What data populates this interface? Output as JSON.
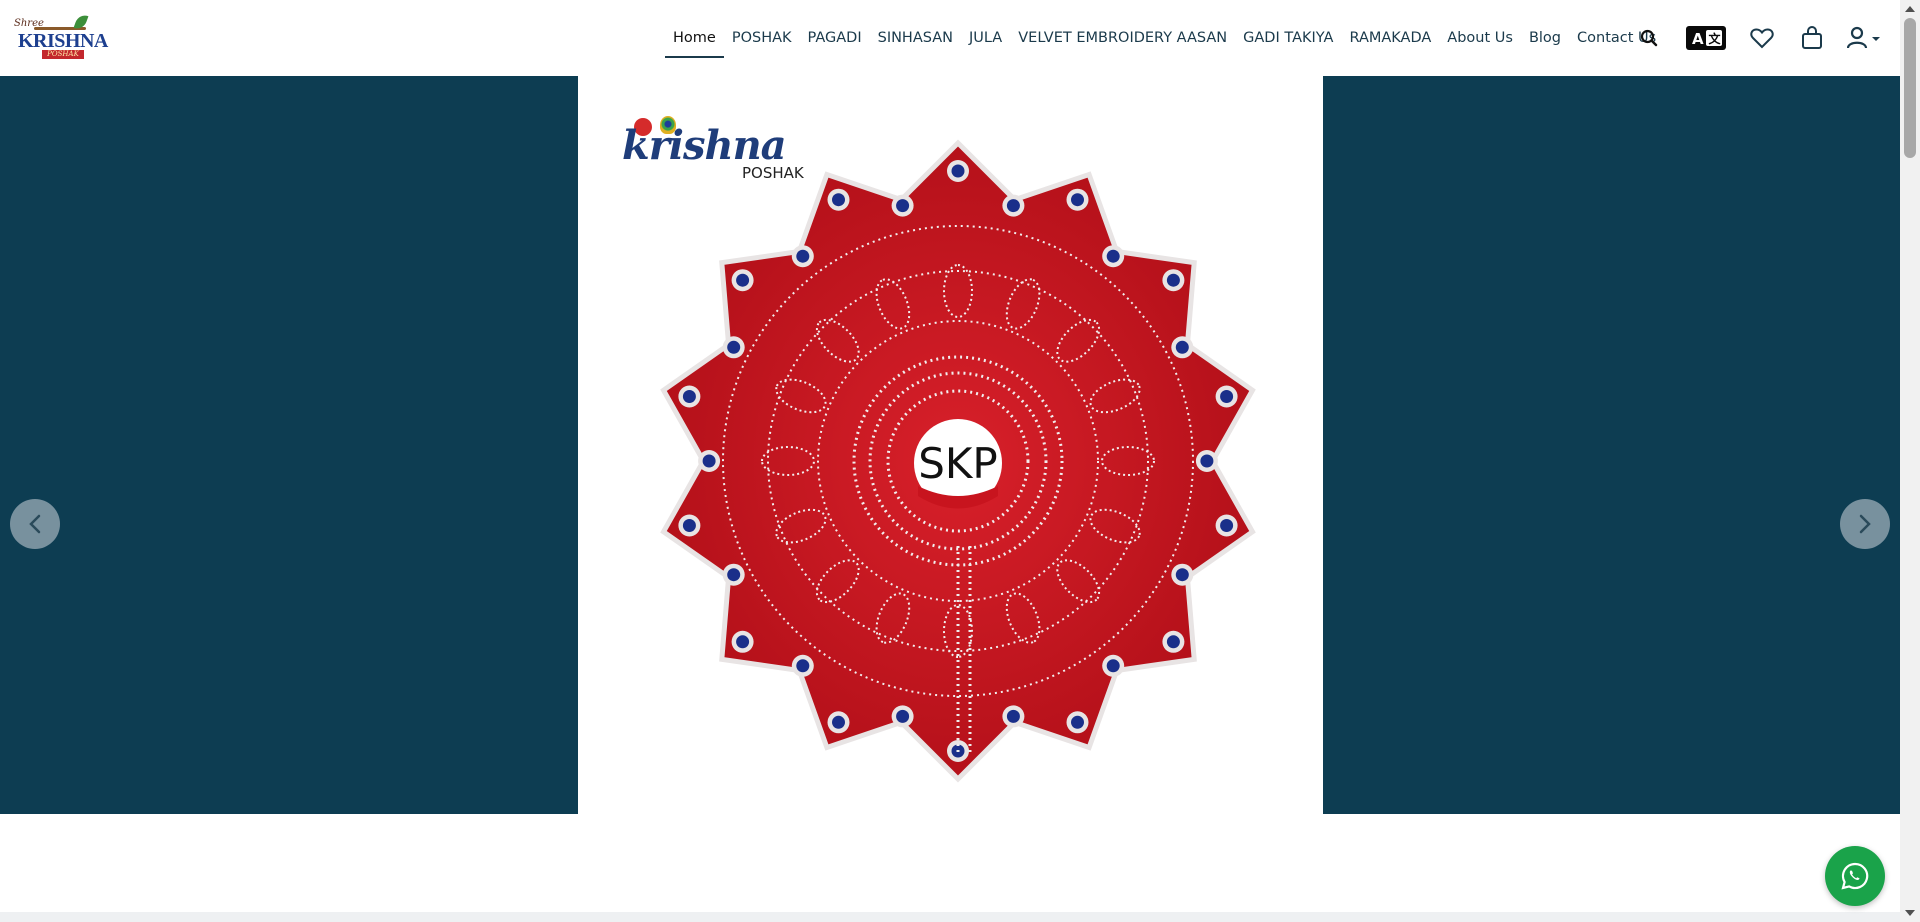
{
  "header": {
    "logo": {
      "shree": "Shree",
      "name": "KRISHNA",
      "tagline": "POSHAK"
    },
    "nav": [
      {
        "label": "Home",
        "active": true
      },
      {
        "label": "POSHAK"
      },
      {
        "label": "PAGADI"
      },
      {
        "label": "SINHASAN"
      },
      {
        "label": "JULA"
      },
      {
        "label": "VELVET EMBROIDERY AASAN"
      },
      {
        "label": "GADI TAKIYA"
      },
      {
        "label": "RAMAKADA"
      },
      {
        "label": "About Us"
      },
      {
        "label": "Blog"
      },
      {
        "label": "Contact Us"
      }
    ],
    "icons": [
      "search-icon",
      "translate-icon",
      "wishlist-heart-icon",
      "shopping-bag-icon",
      "user-account-icon"
    ]
  },
  "hero": {
    "brand_text": "krishna",
    "brand_sub": "POSHAK",
    "center_label": "SKP",
    "colors": {
      "band": "#0d3d52",
      "mandala_red": "#c8141e",
      "stone_blue": "#1a2f8a"
    }
  },
  "whatsapp": {
    "icon": "whatsapp-icon"
  }
}
